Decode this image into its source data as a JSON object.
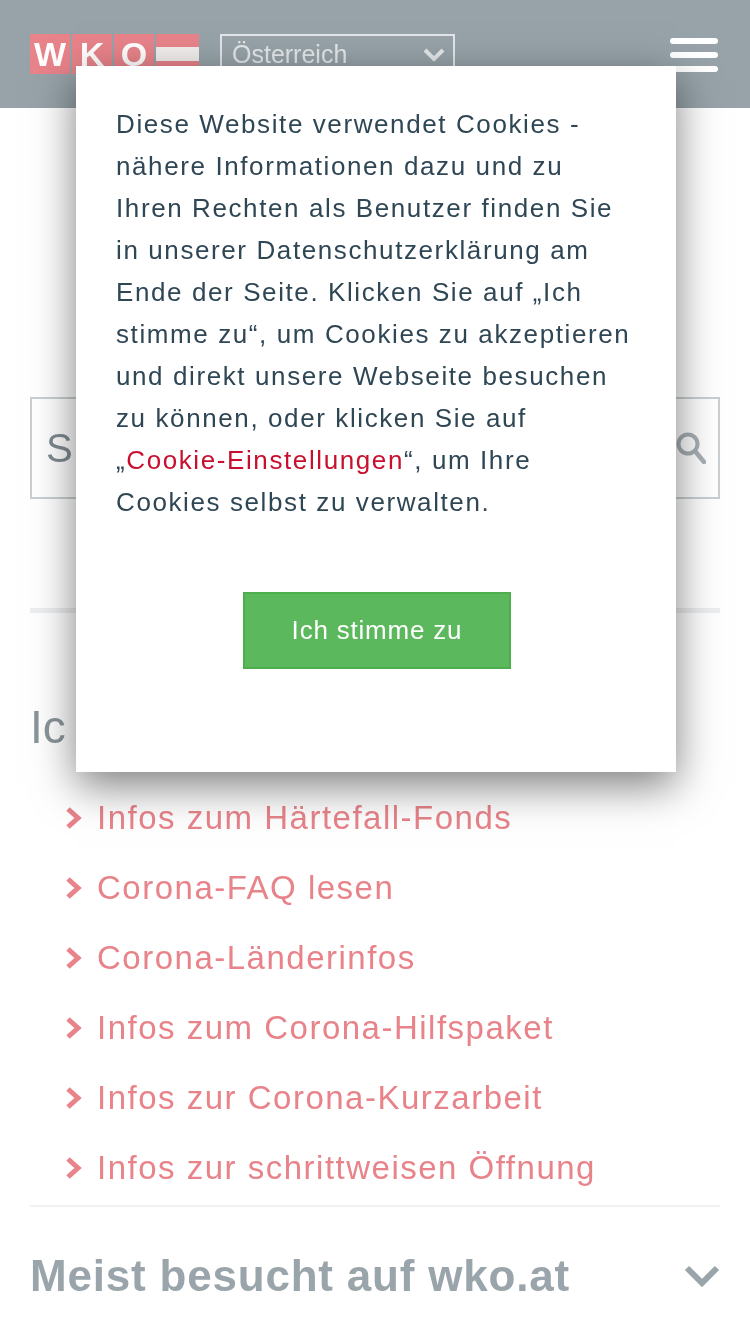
{
  "header": {
    "logo_letters": [
      "W",
      "K",
      "O"
    ],
    "region_select": {
      "value": "Österreich"
    }
  },
  "search": {
    "placeholder": "S"
  },
  "section": {
    "heading": "Ic",
    "links": [
      "Infos zum Härtefall-Fonds",
      "Corona-FAQ lesen",
      "Corona-Länderinfos",
      "Infos zum Corona-Hilfspaket",
      "Infos zur Corona-Kurzarbeit",
      "Infos zur schrittweisen Öffnung"
    ]
  },
  "accordion": {
    "title": "Meist besucht auf wko.at",
    "expanded": false
  },
  "cookie_dialog": {
    "message": [
      {
        "kind": "text",
        "text": "Diese Website verwendet Cookies - nähere Informationen dazu und zu Ihren Rechten als Benutzer finden Sie in unserer Datenschutzerklärung am Ende der Seite. Klicken Sie auf „Ich stimme zu“, um Cookies zu akzeptieren und direkt unsere Webseite besuchen zu können, oder klicken Sie auf „"
      },
      {
        "kind": "link",
        "text": "Cookie-Einstellungen"
      },
      {
        "kind": "text",
        "text": "“, um Ihre Cookies selbst zu verwalten."
      }
    ],
    "button": "Ich stimme zu"
  }
}
